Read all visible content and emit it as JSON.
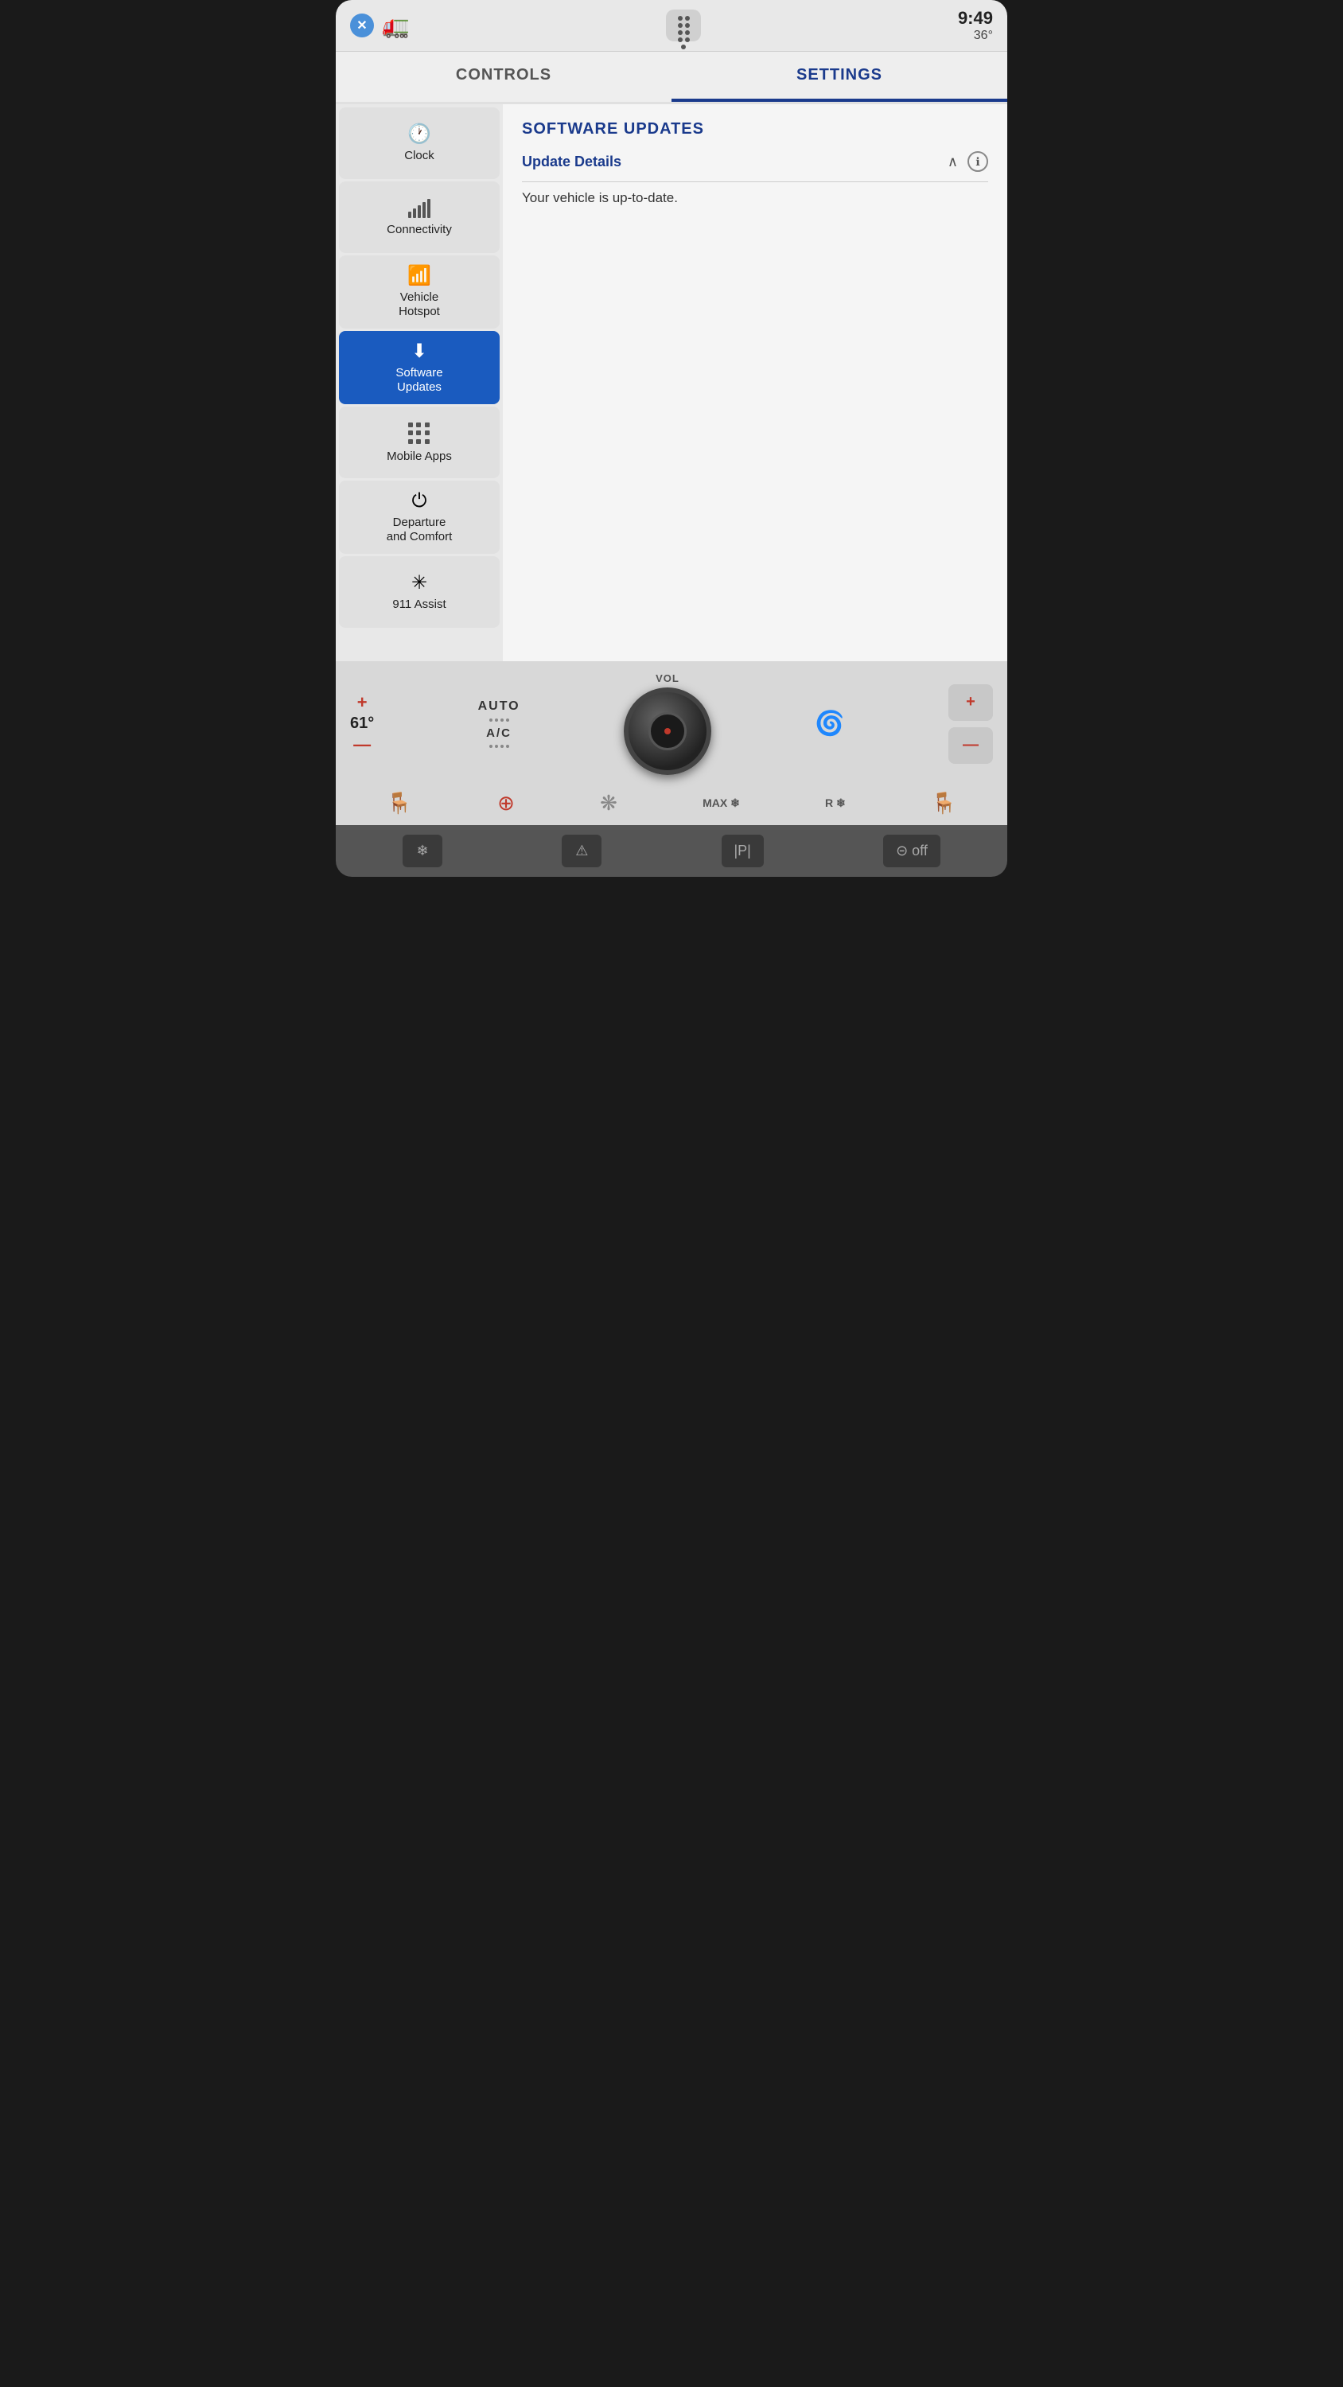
{
  "screen": {
    "close_button": "✕",
    "truck_emoji": "🚛"
  },
  "top_bar": {
    "time": "9:49",
    "temperature": "36°"
  },
  "tabs": [
    {
      "id": "controls",
      "label": "CONTROLS",
      "active": false
    },
    {
      "id": "settings",
      "label": "SETTINGS",
      "active": true
    }
  ],
  "sidebar": {
    "items": [
      {
        "id": "clock",
        "label": "Clock",
        "icon": "clock",
        "active": false
      },
      {
        "id": "connectivity",
        "label": "Connectivity",
        "icon": "signal",
        "active": false
      },
      {
        "id": "vehicle-hotspot",
        "label": "Vehicle Hotspot",
        "icon": "wifi",
        "active": false
      },
      {
        "id": "software-updates",
        "label": "Software Updates",
        "icon": "download",
        "active": true
      },
      {
        "id": "mobile-apps",
        "label": "Mobile Apps",
        "icon": "grid",
        "active": false
      },
      {
        "id": "departure-comfort",
        "label": "Departure and Comfort",
        "icon": "power",
        "active": false
      },
      {
        "id": "911-assist",
        "label": "911 Assist",
        "icon": "snowflake",
        "active": false
      }
    ]
  },
  "content": {
    "section_title": "SOFTWARE UPDATES",
    "update_details_label": "Update Details",
    "status_message": "Your vehicle is up-to-date."
  },
  "bottom_controls": {
    "left_plus": "+",
    "left_temp": "61°",
    "left_minus": "—",
    "auto_label": "AUTO",
    "ac_label": "A/C",
    "vol_label": "VOL",
    "right_plus": "+",
    "right_minus": "—",
    "max_heat_label": "MAX",
    "rear_heat_label": "R",
    "seat_heat_label": "🪑"
  },
  "bottom_icons": [
    {
      "id": "seat-heat",
      "icon": "🪑"
    },
    {
      "id": "steering-heat",
      "icon": "🏎"
    },
    {
      "id": "fan",
      "icon": "💨"
    },
    {
      "id": "max-defrost",
      "icon": "MAX ❄"
    },
    {
      "id": "rear-defrost",
      "icon": "R❄"
    },
    {
      "id": "seat-cool",
      "icon": "🪑"
    }
  ],
  "hw_buttons": [
    {
      "id": "hw-defrost",
      "icon": "❄"
    },
    {
      "id": "hw-warning",
      "icon": "⚠"
    },
    {
      "id": "hw-park",
      "icon": "|P|"
    },
    {
      "id": "hw-off",
      "icon": "⊝off"
    }
  ]
}
